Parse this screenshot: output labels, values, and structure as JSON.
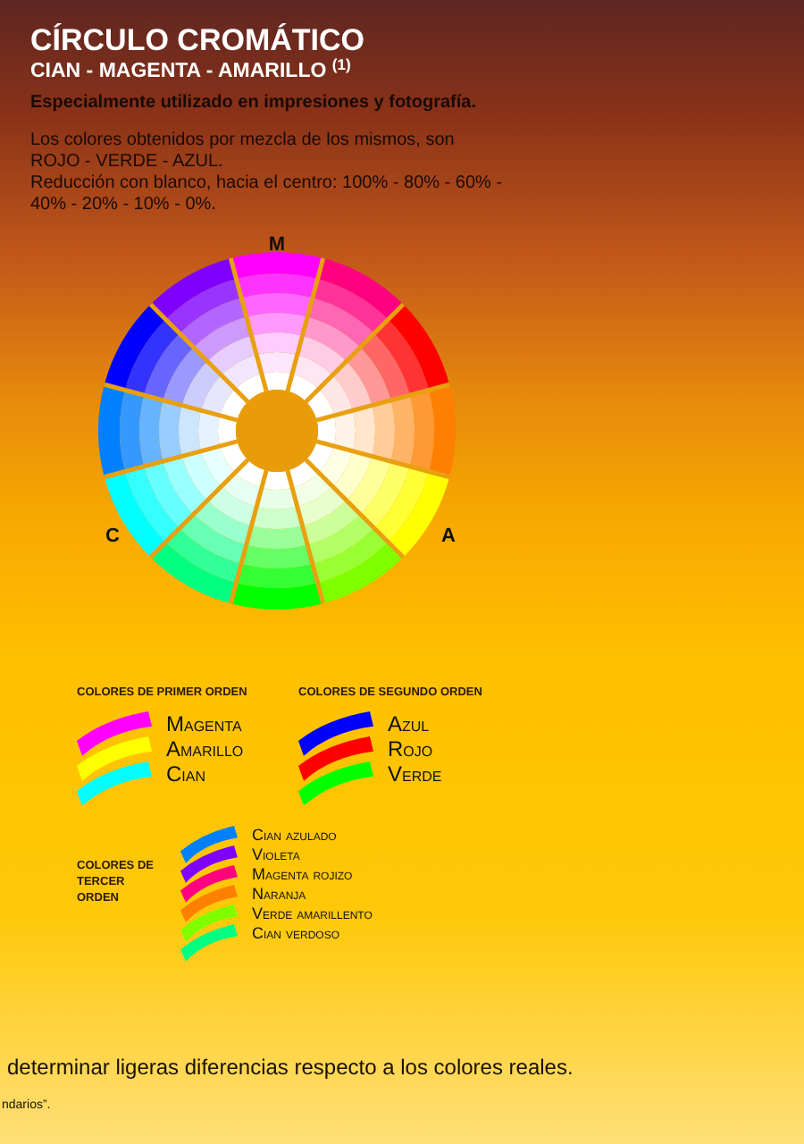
{
  "title": "CÍRCULO CROMÁTICO",
  "subtitle": "CIAN - MAGENTA - AMARILLO $^{(1)}$",
  "tagline": "Especialmente utilizado en impresiones y fotografía.",
  "paragraphs": [
    "Los colores obtenidos por mezcla de los mismos, son ROJO - VERDE - AZUL.",
    "Reducción con blanco, hacia el centro: 100% - 80% - 60% - 40% - 20% - 10% - 0%."
  ],
  "wheel_labels": [
    {
      "text": "M",
      "kind": "top"
    },
    {
      "text": "A",
      "kind": "right"
    },
    {
      "text": "C",
      "kind": "left"
    }
  ],
  "first_order": {
    "heading": "COLORES DE PRIMER ORDEN",
    "items": [
      {
        "label": "Magenta",
        "color": "#ff00ff"
      },
      {
        "label": "Amarillo",
        "color": "#ffff00"
      },
      {
        "label": "Cian",
        "color": "#00ffff"
      }
    ]
  },
  "second_order": {
    "heading": "COLORES DE SEGUNDO ORDEN",
    "items": [
      {
        "label": "Azul",
        "color": "#0000ff"
      },
      {
        "label": "Rojo",
        "color": "#ff0000"
      },
      {
        "label": "Verde",
        "color": "#00ff00"
      }
    ]
  },
  "third_order": {
    "heading": "COLORES DE TERCER ORDEN",
    "items": [
      {
        "label": "Cian azulado",
        "color": "#0080ff"
      },
      {
        "label": "Violeta",
        "color": "#8000ff"
      },
      {
        "label": "Magenta rojizo",
        "color": "#ff0080"
      },
      {
        "label": "Naranja",
        "color": "#ff8000"
      },
      {
        "label": "Verde amarillento",
        "color": "#80ff00"
      },
      {
        "label": "Cian verdoso",
        "color": "#00ff80"
      }
    ]
  },
  "footer_lines": [
    "determinar ligeras diferencias respecto a los colores reales.",
    "ndarios”."
  ]
}
